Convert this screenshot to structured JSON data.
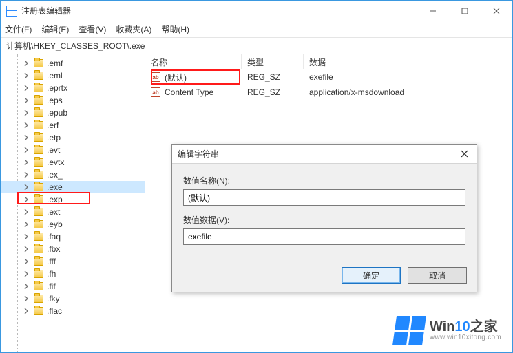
{
  "app": {
    "title": "注册表编辑器"
  },
  "menu": {
    "file": "文件(F)",
    "edit": "编辑(E)",
    "view": "查看(V)",
    "fav": "收藏夹(A)",
    "help": "帮助(H)"
  },
  "address": {
    "path": "计算机\\HKEY_CLASSES_ROOT\\.exe"
  },
  "columns": {
    "name": "名称",
    "type": "类型",
    "data": "数据"
  },
  "rows": [
    {
      "name": "(默认)",
      "type": "REG_SZ",
      "data": "exefile"
    },
    {
      "name": "Content Type",
      "type": "REG_SZ",
      "data": "application/x-msdownload"
    }
  ],
  "tree": {
    "items": [
      ".emf",
      ".eml",
      ".eprtx",
      ".eps",
      ".epub",
      ".erf",
      ".etp",
      ".evt",
      ".evtx",
      ".ex_",
      ".exe",
      ".exp",
      ".ext",
      ".eyb",
      ".faq",
      ".fbx",
      ".fff",
      ".fh",
      ".fif",
      ".fky",
      ".flac"
    ],
    "selected_index": 10
  },
  "dialog": {
    "title": "编辑字符串",
    "name_label": "数值名称(N):",
    "name_value": "(默认)",
    "data_label": "数值数据(V):",
    "data_value": "exefile",
    "ok": "确定",
    "cancel": "取消"
  },
  "watermark": {
    "brand_a": "Win",
    "brand_b": "10",
    "brand_c": "之家",
    "url": "www.win10xitong.com"
  }
}
